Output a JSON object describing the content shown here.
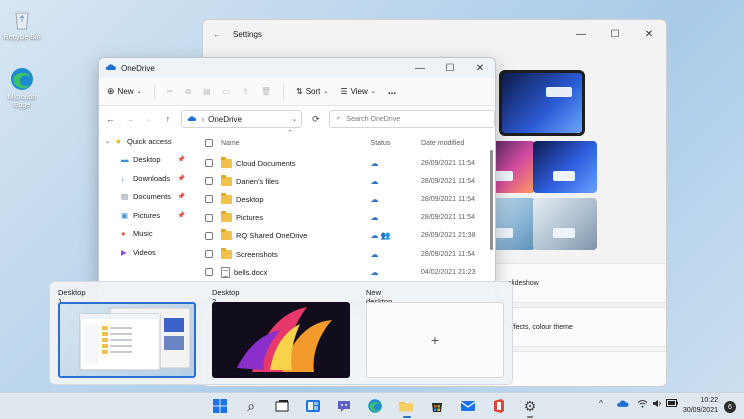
{
  "desktop": {
    "icons": [
      {
        "label": "Recycle Bin",
        "icon": "recycle-bin-icon"
      },
      {
        "label": "Microsoft Edge",
        "icon": "edge-icon"
      }
    ]
  },
  "settings": {
    "title": "Settings",
    "rows": [
      {
        "text": "slideshow"
      },
      {
        "text": "effects, colour theme"
      },
      {
        "text": ""
      }
    ]
  },
  "explorer": {
    "title": "OneDrive",
    "toolbar": {
      "new_label": "New",
      "sort_label": "Sort",
      "view_label": "View",
      "more_label": "..."
    },
    "address": "OneDrive",
    "search_placeholder": "Search OneDrive",
    "nav": [
      {
        "label": "Quick access",
        "icon": "star-icon",
        "pinned": false,
        "expand": true
      },
      {
        "label": "Desktop",
        "icon": "desktop-icon",
        "pinned": true
      },
      {
        "label": "Downloads",
        "icon": "download-icon",
        "pinned": true
      },
      {
        "label": "Documents",
        "icon": "documents-icon",
        "pinned": true
      },
      {
        "label": "Pictures",
        "icon": "pictures-icon",
        "pinned": true
      },
      {
        "label": "Music",
        "icon": "music-icon",
        "pinned": false
      },
      {
        "label": "Videos",
        "icon": "videos-icon",
        "pinned": false
      }
    ],
    "columns": {
      "name": "Name",
      "status": "Status",
      "date": "Date modified"
    },
    "files": [
      {
        "name": "Cloud Documents",
        "type": "folder",
        "status": "☁",
        "date": "28/09/2021 11:54"
      },
      {
        "name": "Darien's files",
        "type": "folder",
        "status": "☁",
        "date": "28/09/2021 11:54"
      },
      {
        "name": "Desktop",
        "type": "folder",
        "status": "☁",
        "date": "28/09/2021 11:54"
      },
      {
        "name": "Pictures",
        "type": "folder",
        "status": "☁",
        "date": "28/09/2021 11:54"
      },
      {
        "name": "RQ Shared OneDrive",
        "type": "folder",
        "status": "☁ 👥",
        "date": "28/09/2021 21:38"
      },
      {
        "name": "Screenshots",
        "type": "folder",
        "status": "☁",
        "date": "28/09/2021 11:54"
      },
      {
        "name": "bells.docx",
        "type": "docx",
        "status": "☁",
        "date": "04/02/2021 21:23"
      }
    ]
  },
  "taskview": {
    "desktops": [
      {
        "label": "Desktop 1"
      },
      {
        "label": "Desktop 2"
      },
      {
        "label": "New desktop",
        "plus": "+"
      }
    ]
  },
  "taskbar": {
    "apps": [
      {
        "name": "start",
        "icon": "windows-start-icon"
      },
      {
        "name": "search",
        "icon": "search-icon"
      },
      {
        "name": "task-view",
        "icon": "task-view-icon"
      },
      {
        "name": "widgets",
        "icon": "widgets-icon"
      },
      {
        "name": "chat",
        "icon": "chat-icon"
      },
      {
        "name": "edge",
        "icon": "edge-icon"
      },
      {
        "name": "file-explorer",
        "icon": "folder-icon"
      },
      {
        "name": "store",
        "icon": "store-icon"
      },
      {
        "name": "mail",
        "icon": "mail-icon"
      },
      {
        "name": "office",
        "icon": "office-icon"
      },
      {
        "name": "settings",
        "icon": "gear-icon"
      }
    ],
    "tray": {
      "chevron": "^",
      "time": "10:22",
      "date": "30/09/2021",
      "notifications": "6"
    }
  }
}
